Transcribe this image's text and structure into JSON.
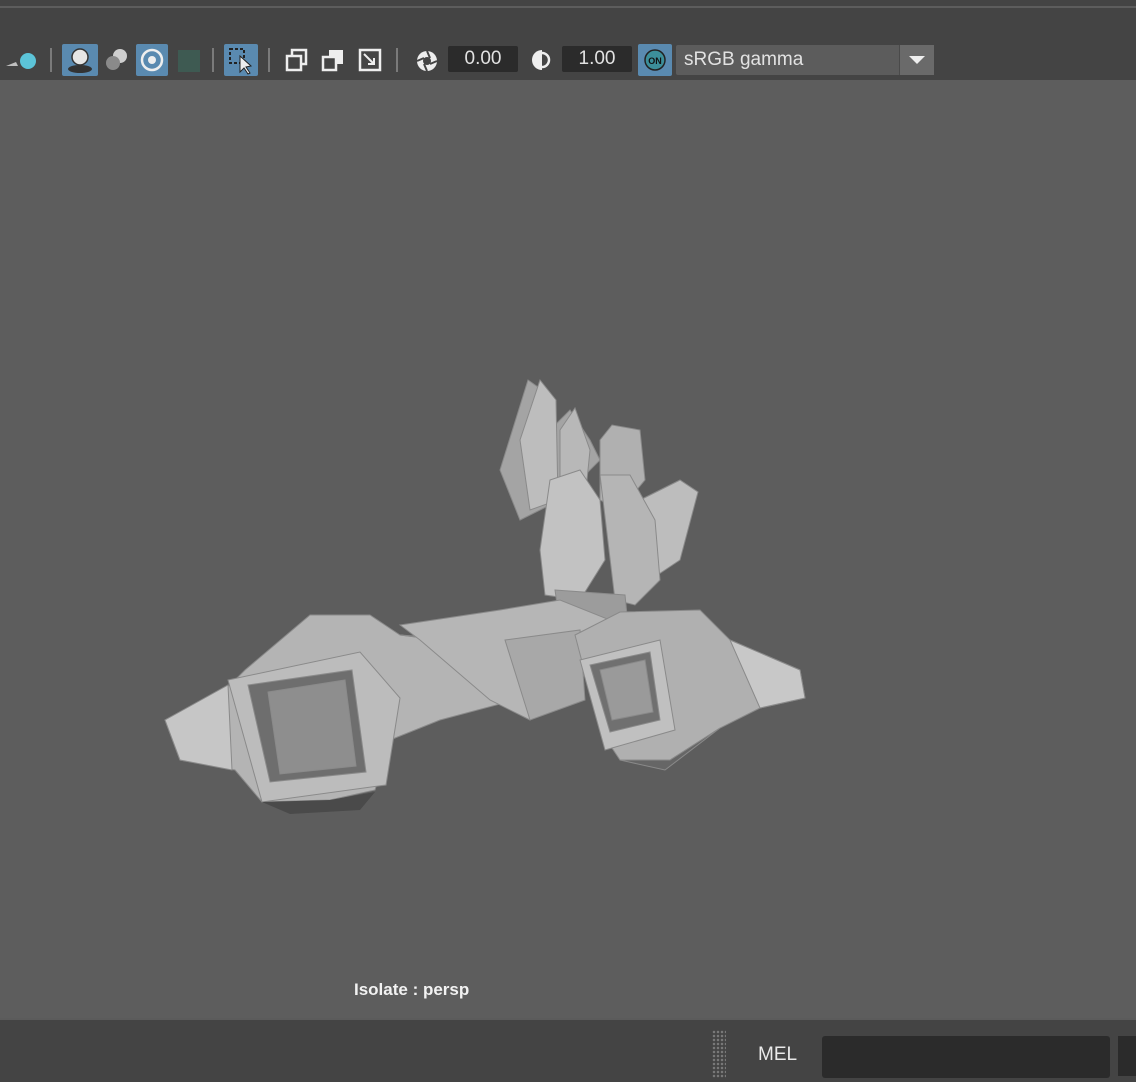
{
  "toolbar": {
    "exposure_value": "0.00",
    "gamma_value": "1.00",
    "colorspace_selected": "sRGB gamma",
    "icons": [
      "light-icon",
      "shadow-icon",
      "ambient-occlusion-icon",
      "anti-aliasing-icon",
      "depth-of-field-icon",
      "isolate-select-icon",
      "xray-icon",
      "xray-joints-icon",
      "xray-component-icon",
      "exposure-icon",
      "gamma-icon",
      "color-management-on-icon"
    ],
    "accent_color": "#5a8ab0"
  },
  "viewport": {
    "label": "Isolate : persp",
    "background_color": "#5d5d5d"
  },
  "command_line": {
    "language_label": "MEL",
    "input_value": ""
  }
}
